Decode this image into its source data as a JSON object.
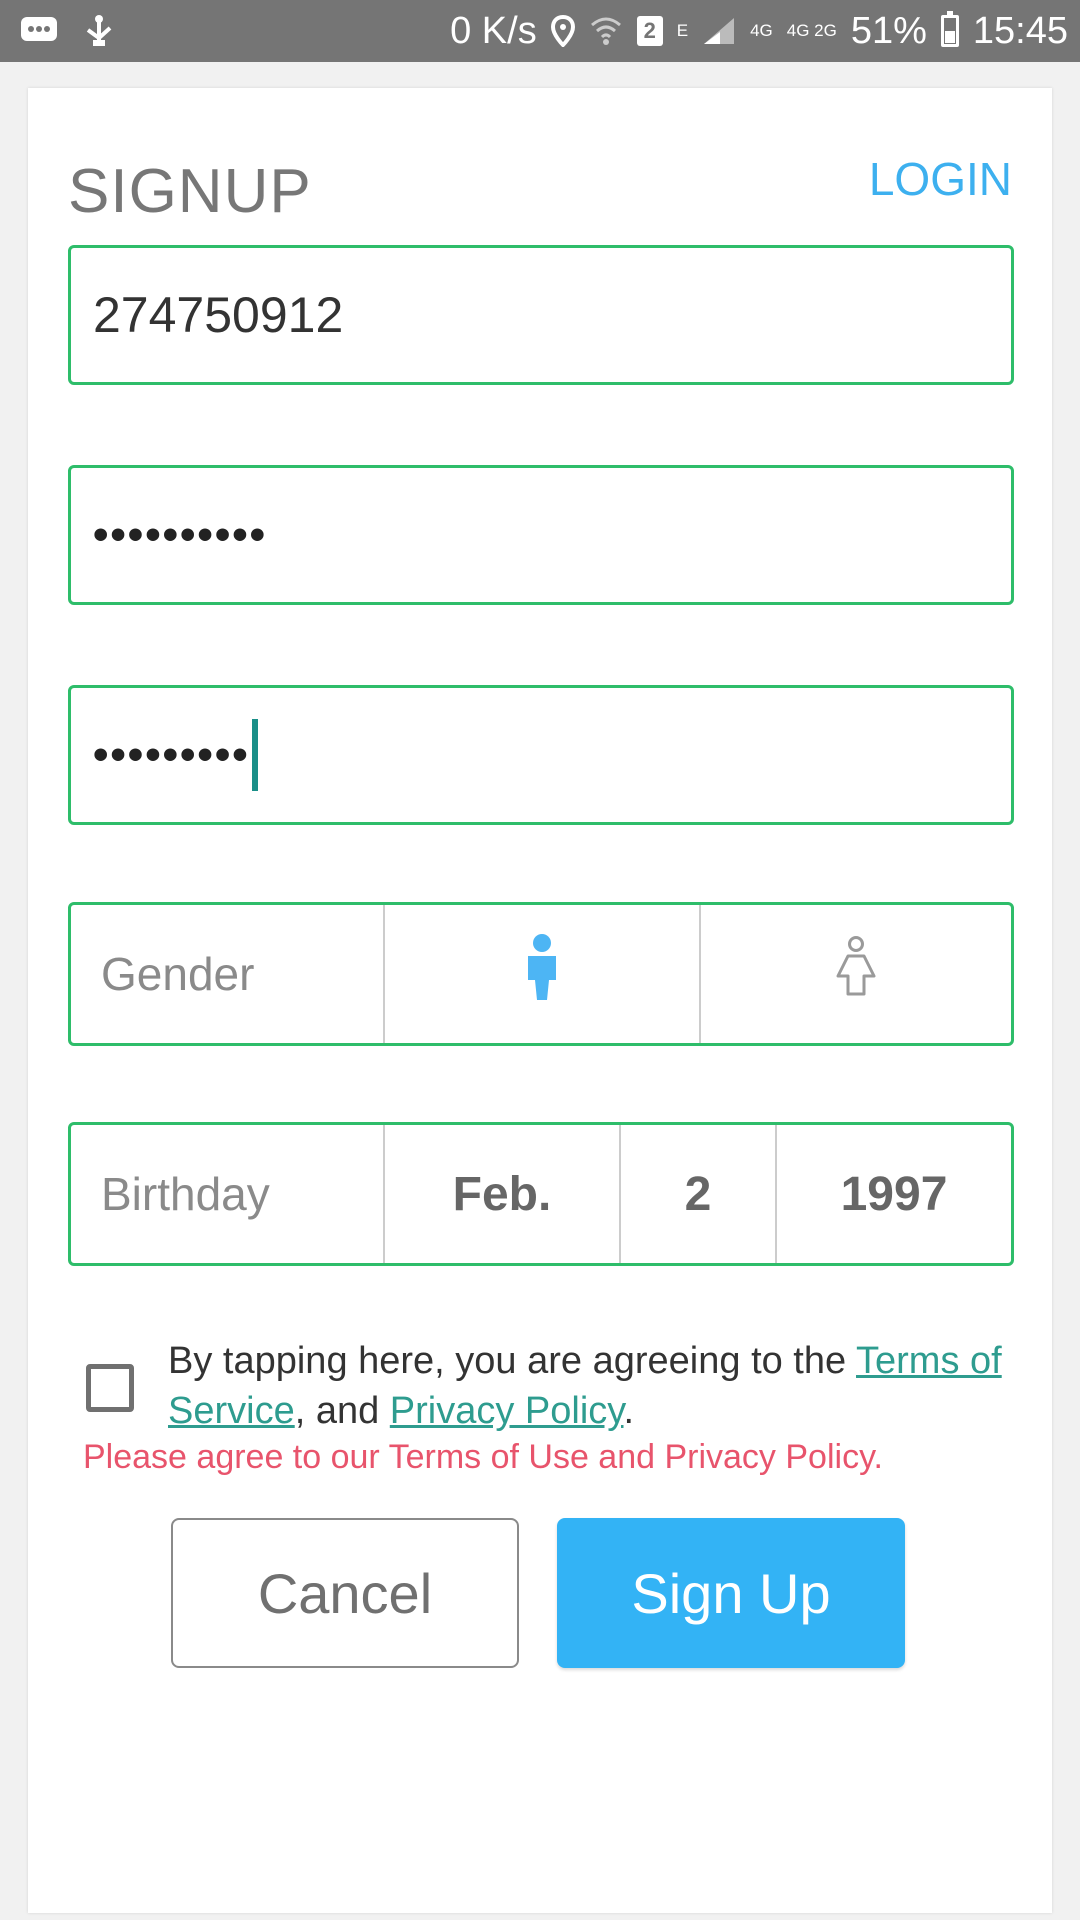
{
  "status_bar": {
    "net_speed": "0 K/s",
    "sim_slot": "2",
    "network_e": "E",
    "network_4g": "4G",
    "network_4g2g": "4G 2G",
    "battery": "51%",
    "time": "15:45",
    "icons": [
      "chat-bubble-icon",
      "usb-icon",
      "location-pin-icon",
      "wifi-icon",
      "sim-icon",
      "signal-icon",
      "battery-icon"
    ]
  },
  "header": {
    "title": "SIGNUP",
    "login_label": "LOGIN"
  },
  "form": {
    "username_value": "274750912",
    "password_value": "••••••••••",
    "confirm_password_value": "•••••••••",
    "gender_label": "Gender",
    "birthday_label": "Birthday",
    "birth_month": "Feb.",
    "birth_day": "2",
    "birth_year": "1997",
    "selected_gender": "male",
    "accent_color": "#2ebd6a"
  },
  "terms": {
    "prefix": "By tapping here, you are agreeing to the ",
    "terms_link": "Terms of Service",
    "middle": ", and ",
    "privacy_link": "Privacy Policy",
    "suffix": ".",
    "error": "Please agree to our Terms of Use and Privacy Policy."
  },
  "buttons": {
    "cancel_label": "Cancel",
    "signup_label": "Sign Up",
    "signup_color": "#33b3f5"
  }
}
